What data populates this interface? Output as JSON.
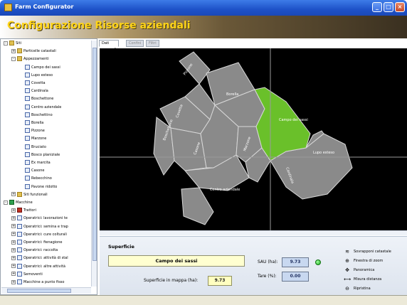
{
  "window": {
    "title": "Farm Configurator"
  },
  "banner": {
    "title": "Configurazione Risorse aziendali"
  },
  "tree": {
    "items": [
      {
        "label": "Siti",
        "level": 0,
        "icon": "folder",
        "expander": "-"
      },
      {
        "label": "Particelle catastali",
        "level": 1,
        "icon": "folder",
        "expander": "+"
      },
      {
        "label": "Appezzamenti",
        "level": 1,
        "icon": "folder",
        "expander": "-"
      },
      {
        "label": "Campo dei sassi",
        "level": 2,
        "icon": "doc"
      },
      {
        "label": "Lupo esteso",
        "level": 2,
        "icon": "doc"
      },
      {
        "label": "Covetta",
        "level": 2,
        "icon": "doc"
      },
      {
        "label": "Cardinala",
        "level": 2,
        "icon": "doc"
      },
      {
        "label": "Boschettone",
        "level": 2,
        "icon": "doc"
      },
      {
        "label": "Centro aziendale",
        "level": 2,
        "icon": "doc"
      },
      {
        "label": "Boschettino",
        "level": 2,
        "icon": "doc"
      },
      {
        "label": "Borella",
        "level": 2,
        "icon": "doc"
      },
      {
        "label": "Pizzone",
        "level": 2,
        "icon": "doc"
      },
      {
        "label": "Marzone",
        "level": 2,
        "icon": "doc"
      },
      {
        "label": "Bruciato",
        "level": 2,
        "icon": "doc"
      },
      {
        "label": "Bosco planiziale",
        "level": 2,
        "icon": "doc"
      },
      {
        "label": "Ex marcita",
        "level": 2,
        "icon": "doc"
      },
      {
        "label": "Casone",
        "level": 2,
        "icon": "doc"
      },
      {
        "label": "Rebecchino",
        "level": 2,
        "icon": "doc"
      },
      {
        "label": "Pavone ridotto",
        "level": 2,
        "icon": "doc"
      },
      {
        "label": "Siti funzionali",
        "level": 1,
        "icon": "folder",
        "expander": "+"
      },
      {
        "label": "Macchine",
        "level": 0,
        "icon": "machine",
        "expander": "-"
      },
      {
        "label": "Trattori",
        "level": 1,
        "icon": "tractor",
        "expander": "+"
      },
      {
        "label": "Operatrici: lavorazioni te",
        "level": 1,
        "icon": "doc",
        "expander": "+"
      },
      {
        "label": "Operatrici: semina e trap",
        "level": 1,
        "icon": "doc",
        "expander": "+"
      },
      {
        "label": "Operatrici: cure colturali",
        "level": 1,
        "icon": "doc",
        "expander": "+"
      },
      {
        "label": "Operatrici: fienagione",
        "level": 1,
        "icon": "doc",
        "expander": "+"
      },
      {
        "label": "Operatrici: raccolta",
        "level": 1,
        "icon": "doc",
        "expander": "+"
      },
      {
        "label": "Operatrici: attività di stal",
        "level": 1,
        "icon": "doc",
        "expander": "+"
      },
      {
        "label": "Operatrici: altre attività",
        "level": 1,
        "icon": "doc",
        "expander": "+"
      },
      {
        "label": "Semoventi",
        "level": 1,
        "icon": "doc",
        "expander": "+"
      },
      {
        "label": "Macchine a punto fisso",
        "level": 1,
        "icon": "doc",
        "expander": "+"
      }
    ]
  },
  "tabs": [
    {
      "label": "Dati generali",
      "active": true
    },
    {
      "label": "Confini",
      "active": false
    },
    {
      "label": "Filtri",
      "active": false
    }
  ],
  "map": {
    "labels": [
      {
        "text": "Borella"
      },
      {
        "text": "Pizzone"
      },
      {
        "text": "Campo dei sassi"
      },
      {
        "text": "Lupo esteso"
      },
      {
        "text": "Centro aziendale"
      },
      {
        "text": "Boschettone"
      },
      {
        "text": "Casone"
      },
      {
        "text": "Covetta"
      },
      {
        "text": "Marzone"
      },
      {
        "text": "Cardinala"
      }
    ]
  },
  "panel": {
    "header": "Superficie",
    "field_name": "Campo dei sassi",
    "map_area_label": "Superficie in mappa (ha):",
    "map_area_value": "9.73",
    "sau_label": "SAU (ha):",
    "sau_value": "9.73",
    "tare_label": "Tare (%):",
    "tare_value": "0.00"
  },
  "actions": [
    {
      "label": "Sovrapponi catastale",
      "icon": "layers-icon"
    },
    {
      "label": "Finestra di zoom",
      "icon": "zoom-window-icon"
    },
    {
      "label": "Panoramica",
      "icon": "pan-icon"
    },
    {
      "label": "Misura distanza",
      "icon": "ruler-icon"
    },
    {
      "label": "Ripristina",
      "icon": "zoom-reset-icon"
    }
  ],
  "colors": {
    "selected_field": "#6ac02a",
    "field": "#8a8a8a",
    "map_bg": "#000000",
    "banner_text": "#ffd418"
  }
}
